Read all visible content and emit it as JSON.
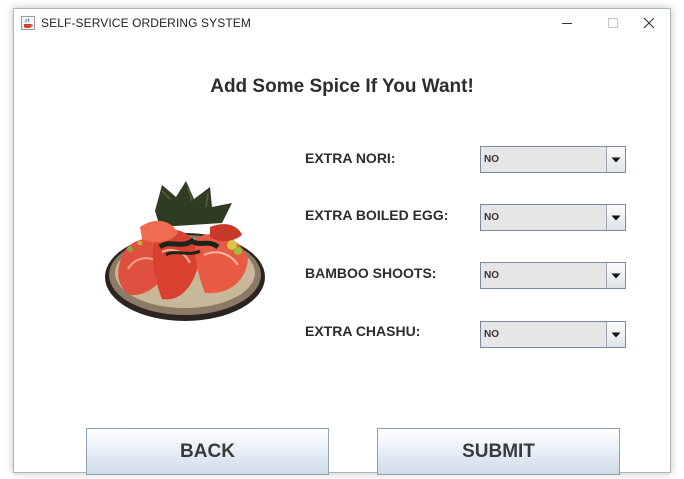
{
  "window": {
    "title": "SELF-SERVICE ORDERING SYSTEM",
    "minimize_glyph": "–",
    "maximize_glyph": "□",
    "close_glyph": "✕"
  },
  "page": {
    "heading": "Add Some Spice If You Want!"
  },
  "options": [
    {
      "label": "EXTRA NORI:",
      "value": "NO"
    },
    {
      "label": "EXTRA BOILED EGG:",
      "value": "NO"
    },
    {
      "label": "BAMBOO SHOOTS:",
      "value": "NO"
    },
    {
      "label": "EXTRA CHASHU:",
      "value": "NO"
    }
  ],
  "buttons": {
    "back": "BACK",
    "submit": "SUBMIT"
  },
  "colors": {
    "button_gradient_bottom": "#cfdbe8",
    "combo_background": "#e6e6e6",
    "combo_border": "#7a8a9f",
    "text": "#2d2d2d"
  },
  "icons": {
    "app": "java-coffee-cup-icon",
    "combo_arrow": "triangle-down-icon"
  }
}
